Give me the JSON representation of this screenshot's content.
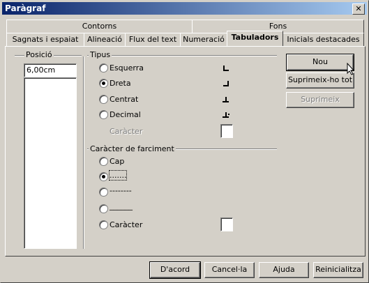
{
  "window": {
    "title": "Paràgraf",
    "close_glyph": "✕"
  },
  "tabs_row1": [
    "Contorns",
    "Fons"
  ],
  "tabs_row2": [
    "Sagnats i espaiat",
    "Alineació",
    "Flux del text",
    "Numeració",
    "Tabuladors",
    "Inicials destacades"
  ],
  "active_tab": "Tabuladors",
  "position": {
    "label": "Posició",
    "value": "6,00cm"
  },
  "type": {
    "label": "Tipus",
    "options": [
      "Esquerra",
      "Dreta",
      "Centrat",
      "Decimal"
    ],
    "selected": "Dreta",
    "character_label": "Caràcter"
  },
  "fill": {
    "label": "Caràcter de farciment",
    "options": [
      "Cap",
      ".......",
      "--------",
      "______",
      "Caràcter"
    ],
    "selected": "......."
  },
  "side_buttons": {
    "new": "Nou",
    "delete_all": "Suprimeix-ho tot",
    "delete": "Suprimeix"
  },
  "footer_buttons": {
    "ok": "D'acord",
    "cancel": "Cancel·la",
    "help": "Ajuda",
    "reset": "Reinicialitza"
  }
}
